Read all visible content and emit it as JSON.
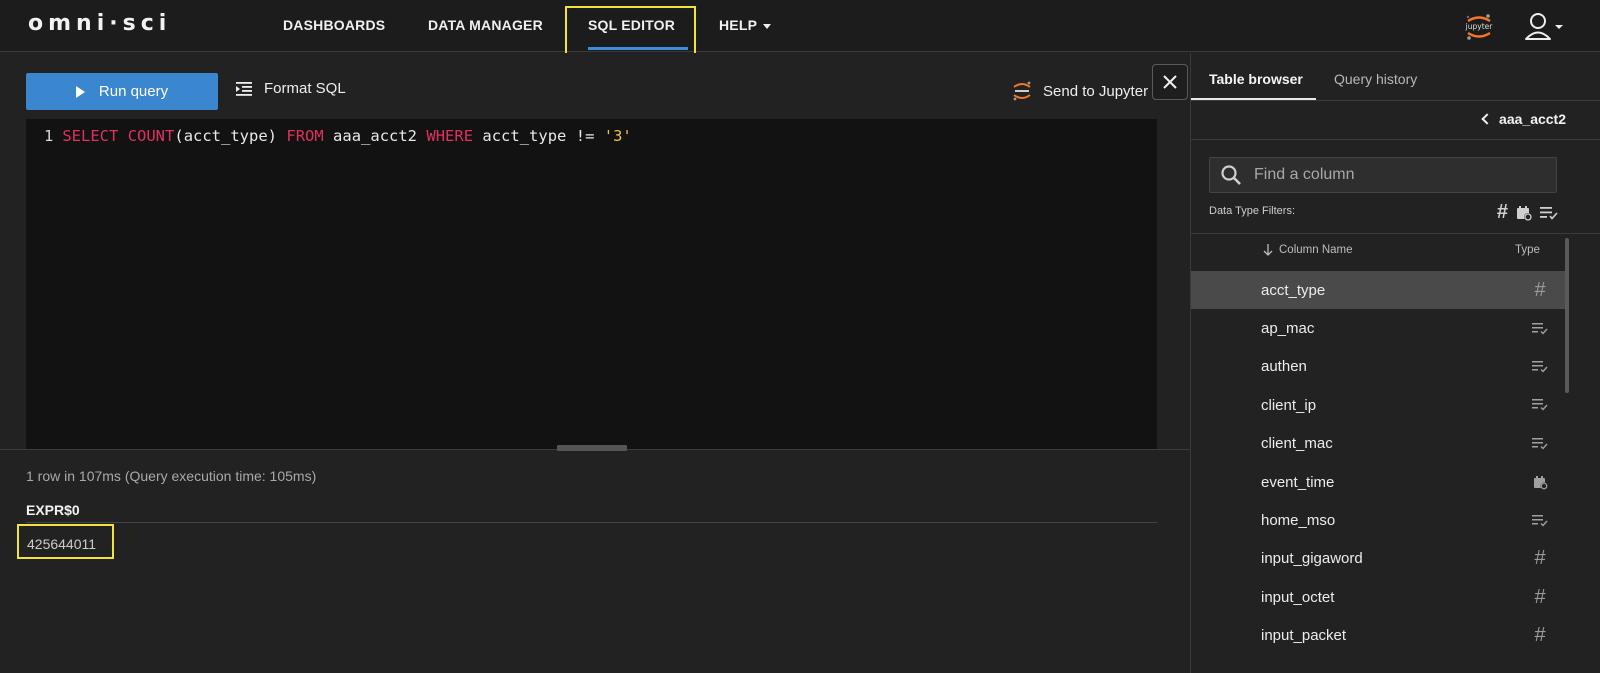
{
  "app": {
    "logo_text": "omni·sci"
  },
  "nav": {
    "items": [
      {
        "label": "DASHBOARDS"
      },
      {
        "label": "DATA MANAGER"
      },
      {
        "label": "SQL EDITOR",
        "active": true
      },
      {
        "label": "HELP"
      }
    ],
    "jupyter_badge_label": "jupyter"
  },
  "toolbar": {
    "run_label": "Run query",
    "format_label": "Format SQL",
    "jupyter_label": "Send to Jupyter"
  },
  "editor": {
    "line_number": "1",
    "tokens": {
      "kw_select": "SELECT",
      "kw_count": "COUNT",
      "arg": "(acct_type)",
      "kw_from": "FROM",
      "table": "aaa_acct2",
      "kw_where": "WHERE",
      "column": "acct_type",
      "operator": "!=",
      "literal": "'3'"
    }
  },
  "results": {
    "status": "1 row in 107ms (Query execution time: 105ms)",
    "column_header": "EXPR$0",
    "value": "425644011"
  },
  "sidebar": {
    "tabs": [
      {
        "label": "Table browser",
        "active": true
      },
      {
        "label": "Query history",
        "active": false
      }
    ],
    "table_name": "aaa_acct2",
    "search_placeholder": "Find a column",
    "filters_label": "Data Type Filters:",
    "column_name_header": "Column Name",
    "type_header": "Type",
    "columns": [
      {
        "name": "acct_type",
        "type": "number",
        "icon": "hash-icon"
      },
      {
        "name": "ap_mac",
        "type": "text",
        "icon": "text-type-icon"
      },
      {
        "name": "authen",
        "type": "text",
        "icon": "text-type-icon"
      },
      {
        "name": "client_ip",
        "type": "text",
        "icon": "text-type-icon"
      },
      {
        "name": "client_mac",
        "type": "text",
        "icon": "text-type-icon"
      },
      {
        "name": "event_time",
        "type": "datetime",
        "icon": "calendar-clock-icon"
      },
      {
        "name": "home_mso",
        "type": "text",
        "icon": "text-type-icon"
      },
      {
        "name": "input_gigaword",
        "type": "number",
        "icon": "hash-icon"
      },
      {
        "name": "input_octet",
        "type": "number",
        "icon": "hash-icon"
      },
      {
        "name": "input_packet",
        "type": "number",
        "icon": "hash-icon"
      }
    ]
  },
  "colors": {
    "accent_blue": "#3a86cf",
    "keyword_red": "#e0315d",
    "string_yellow": "#f0c040",
    "highlight_yellow": "#f2e23a"
  }
}
